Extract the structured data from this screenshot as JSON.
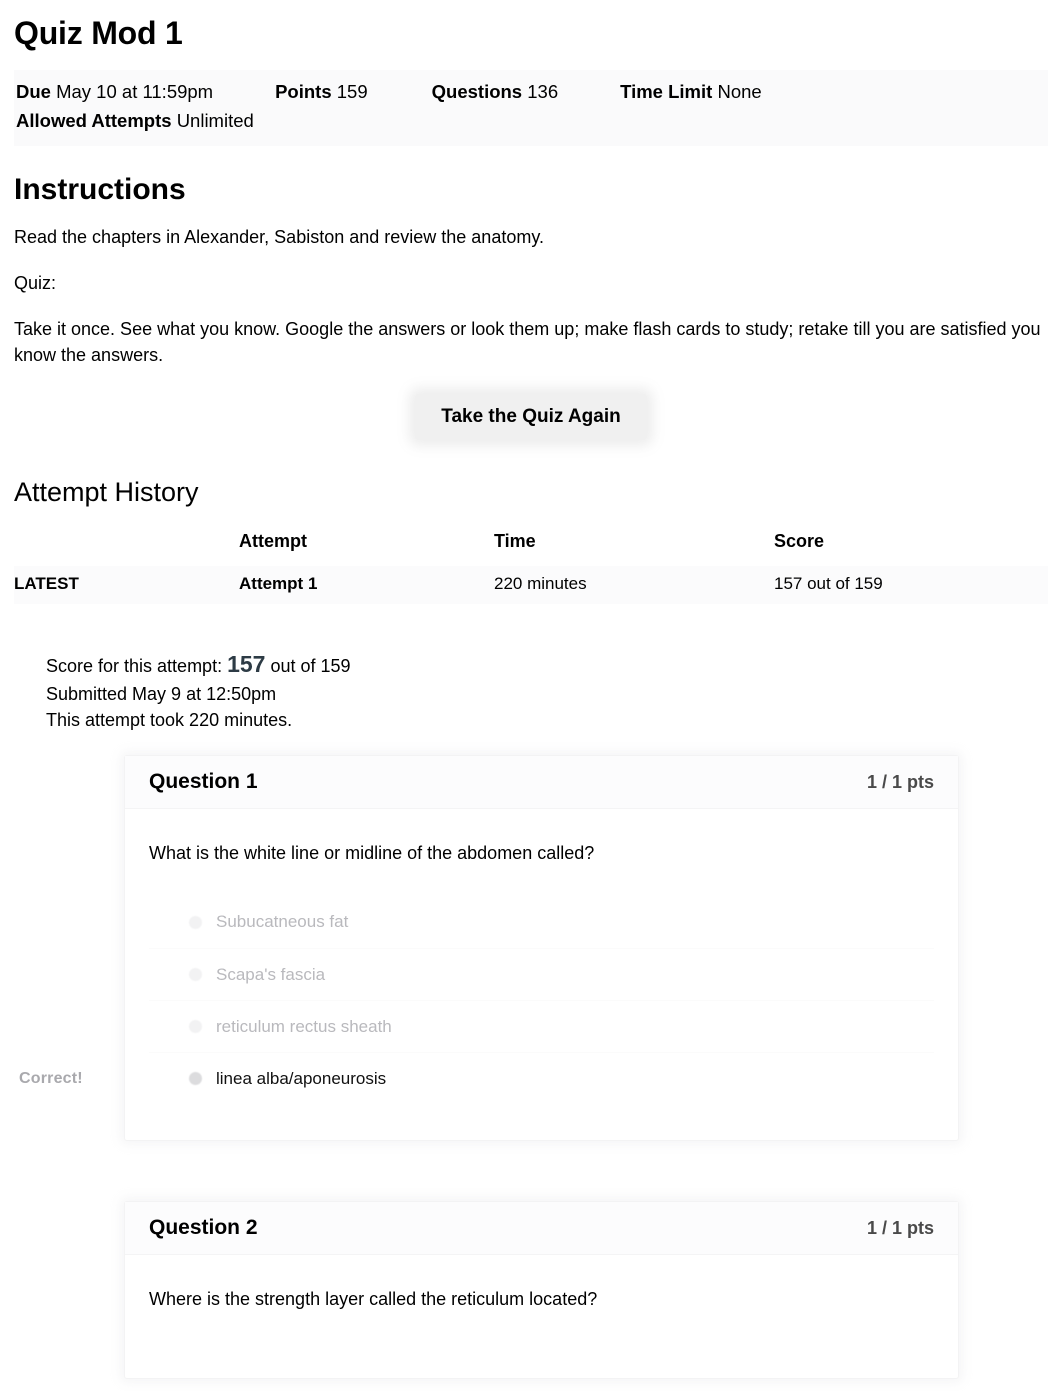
{
  "quiz": {
    "title": "Quiz Mod 1",
    "meta": {
      "due_label": "Due",
      "due_value": "May 10 at 11:59pm",
      "points_label": "Points",
      "points_value": "159",
      "questions_label": "Questions",
      "questions_value": "136",
      "time_limit_label": "Time Limit",
      "time_limit_value": "None",
      "allowed_attempts_label": "Allowed Attempts",
      "allowed_attempts_value": "Unlimited"
    }
  },
  "instructions": {
    "heading": "Instructions",
    "paragraphs": [
      "Read the chapters in Alexander, Sabiston and review the anatomy.",
      "Quiz:",
      "Take it once. See what you know. Google the answers or look them up; make flash cards to study; retake till you are satisfied you know the answers."
    ],
    "retake_button": "Take the Quiz Again"
  },
  "attempt_history": {
    "heading": "Attempt History",
    "columns": [
      "",
      "Attempt",
      "Time",
      "Score"
    ],
    "rows": [
      {
        "kept": "LATEST",
        "attempt": "Attempt 1",
        "time": "220 minutes",
        "score": "157 out of 159"
      }
    ]
  },
  "score_summary": {
    "prefix": "Score for this attempt:",
    "score": "157",
    "suffix": "out of 159",
    "submitted": "Submitted May 9 at 12:50pm",
    "duration": "This attempt took 220 minutes."
  },
  "questions": [
    {
      "name": "Question 1",
      "points": "1 / 1 pts",
      "text": "What is the white line or midline of the abdomen called?",
      "answers": [
        {
          "text": "Subucatneous fat",
          "selected": false,
          "status": ""
        },
        {
          "text": "Scapa's fascia",
          "selected": false,
          "status": ""
        },
        {
          "text": "reticulum rectus sheath",
          "selected": false,
          "status": ""
        },
        {
          "text": "linea alba/aponeurosis",
          "selected": true,
          "status": "Correct!"
        }
      ]
    },
    {
      "name": "Question 2",
      "points": "1 / 1 pts",
      "text": "Where is the strength layer called the reticulum located?",
      "answers": []
    }
  ],
  "colors": {
    "page_background": "#ffffff",
    "text_primary": "#000000",
    "text_muted": "#b9b9bd",
    "band_background": "#fafafb",
    "button_background": "#f0f0f0"
  }
}
